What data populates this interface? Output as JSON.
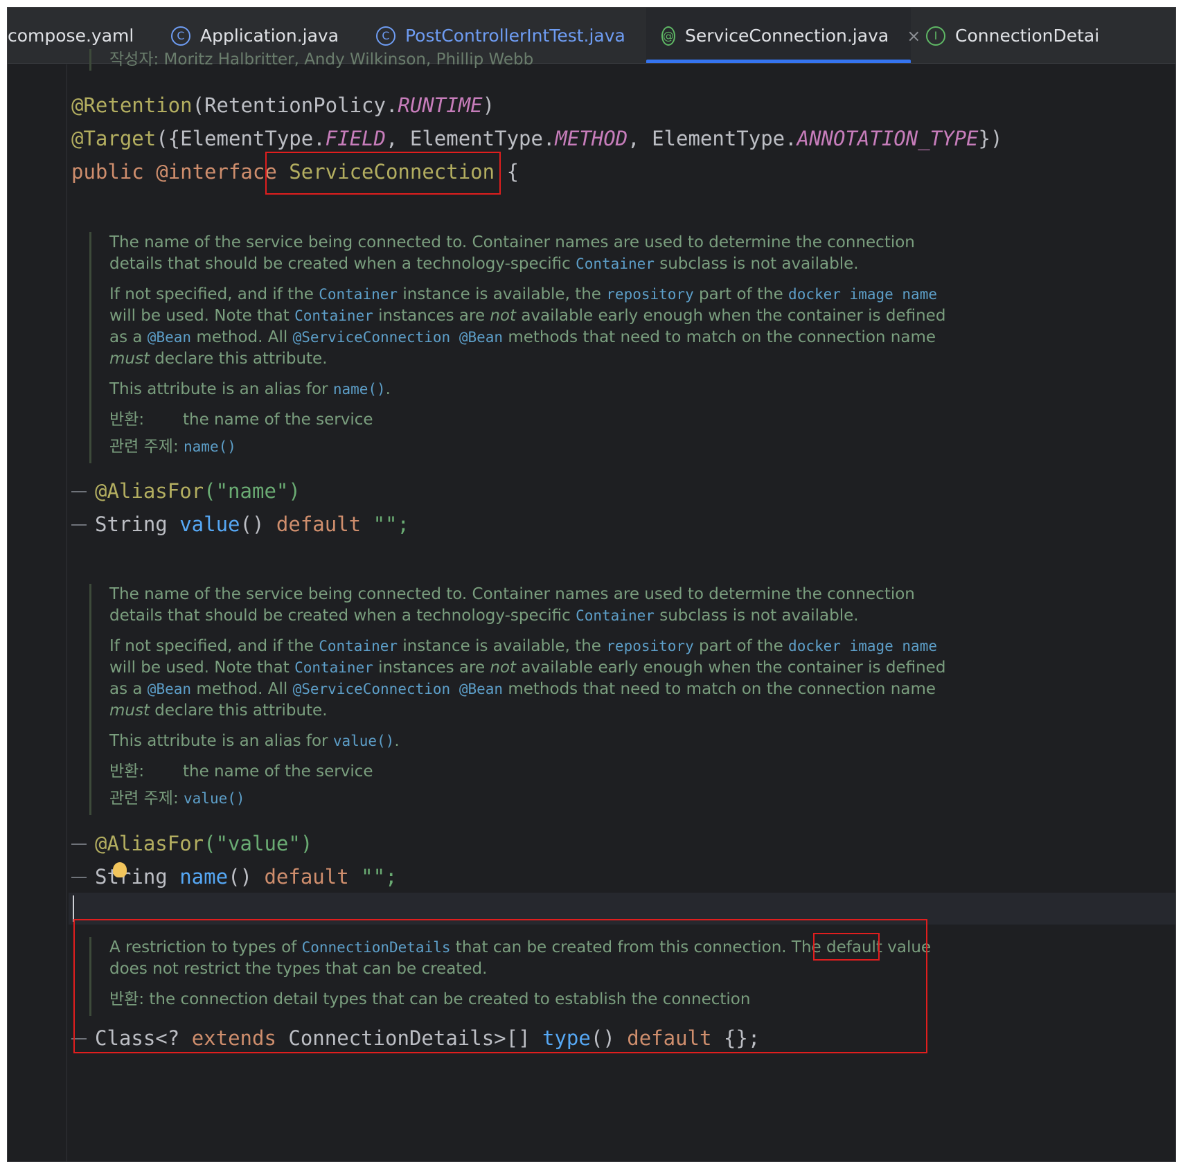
{
  "tabs": [
    {
      "label": "compose.yaml",
      "icon": "",
      "color": "#dfe1e5"
    },
    {
      "label": "Application.java",
      "icon": "class-run-icon",
      "color": "#dfe1e5"
    },
    {
      "label": "PostControllerIntTest.java",
      "icon": "class-icon",
      "color": "#6e9cf2"
    },
    {
      "label": "ServiceConnection.java",
      "icon": "annotation-icon",
      "color": "#dfe1e5"
    },
    {
      "label": "ConnectionDetai",
      "icon": "interface-icon",
      "color": "#dfe1e5"
    }
  ],
  "active_tab_close": "×",
  "header_partial": "작성자:     Moritz Halbritter, Andy Wilkinson, Phillip Webb",
  "code": {
    "retention": {
      "ann": "@Retention",
      "open": "(RetentionPolicy.",
      "val": "RUNTIME",
      "close": ")"
    },
    "target": {
      "ann": "@Target",
      "p1": "({ElementType.",
      "v1": "FIELD",
      "p2": ", ElementType.",
      "v2": "METHOD",
      "p3": ", ElementType.",
      "v3": "ANNOTATION_TYPE",
      "close": "})"
    },
    "decl": {
      "kw": "public @interface",
      "name": "ServiceConnection",
      "brace": "{"
    },
    "alias1": {
      "ann": "@AliasFor",
      "arg": "(\"name\")"
    },
    "value_line": {
      "type": "String ",
      "fn": "value",
      "paren": "() ",
      "kw": "default",
      "rest": " \"\";"
    },
    "alias2": {
      "ann": "@AliasFor",
      "arg": "(\"value\")"
    },
    "name_line": {
      "type": "String ",
      "fn": "name",
      "paren": "() ",
      "kw": "default",
      "rest": " \"\";"
    },
    "type_line": {
      "p1": "Class<? ",
      "kw1": "extends",
      "p2": " ConnectionDetails>[] ",
      "fn": "type",
      "paren": "() ",
      "kw2": "default",
      "rest": " {};"
    }
  },
  "doc1": {
    "p1a": "The name of the service being connected to. Container names are used to determine the connection details that should be created when a technology-specific ",
    "p1code": "Container",
    "p1b": " subclass is not available.",
    "p2a": "If not specified, and if the ",
    "p2c1": "Container",
    "p2b": " instance is available, the ",
    "p2c2": "repository",
    "p2c": " part of the ",
    "p2c3": "docker image name",
    "p2d": " will be used. Note that ",
    "p2c4": "Container",
    "p2e": " instances are ",
    "p2em1": "not",
    "p2f": " available early enough when the container is defined as a ",
    "p2c5": "@Bean",
    "p2g": " method. All ",
    "p2c6": "@ServiceConnection @Bean",
    "p2h": " methods that need to match on the connection name ",
    "p2em2": "must",
    "p2i": " declare this attribute.",
    "p3a": "This attribute is an alias for ",
    "p3code": "name()",
    "p3b": ".",
    "returns_label": "반환:",
    "returns_text": "the name of the service",
    "see_label": "관련 주제:",
    "see_code": "name()"
  },
  "doc2": {
    "p1a": "The name of the service being connected to. Container names are used to determine the connection details that should be created when a technology-specific ",
    "p1code": "Container",
    "p1b": " subclass is not available.",
    "p2a": "If not specified, and if the ",
    "p2c1": "Container",
    "p2b": " instance is available, the ",
    "p2c2": "repository",
    "p2c": " part of the ",
    "p2c3": "docker image name",
    "p2d": " will be used. Note that ",
    "p2c4": "Container",
    "p2e": " instances are ",
    "p2em1": "not",
    "p2f": " available early enough when the container is defined as a ",
    "p2c5": "@Bean",
    "p2g": " method. All ",
    "p2c6": "@ServiceConnection @Bean",
    "p2h": " methods that need to match on the connection name ",
    "p2em2": "must",
    "p2i": " declare this attribute.",
    "p3a": "This attribute is an alias for ",
    "p3code": "value()",
    "p3b": ".",
    "returns_label": "반환:",
    "returns_text": "the name of the service",
    "see_label": "관련 주제:",
    "see_code": "value()"
  },
  "doc3": {
    "p1a": "A restriction to types of ",
    "p1code": "ConnectionDetails",
    "p1b": " that can be created from this connection. The ",
    "p1c": "default",
    "p1d": " value does not restrict the types that can be created.",
    "returns_label": "반환:",
    "returns_text": "the connection detail types that can be created to establish the connection"
  },
  "colors": {
    "highlight_box": "#e01e1e",
    "active_tab_underline": "#3574f0"
  }
}
